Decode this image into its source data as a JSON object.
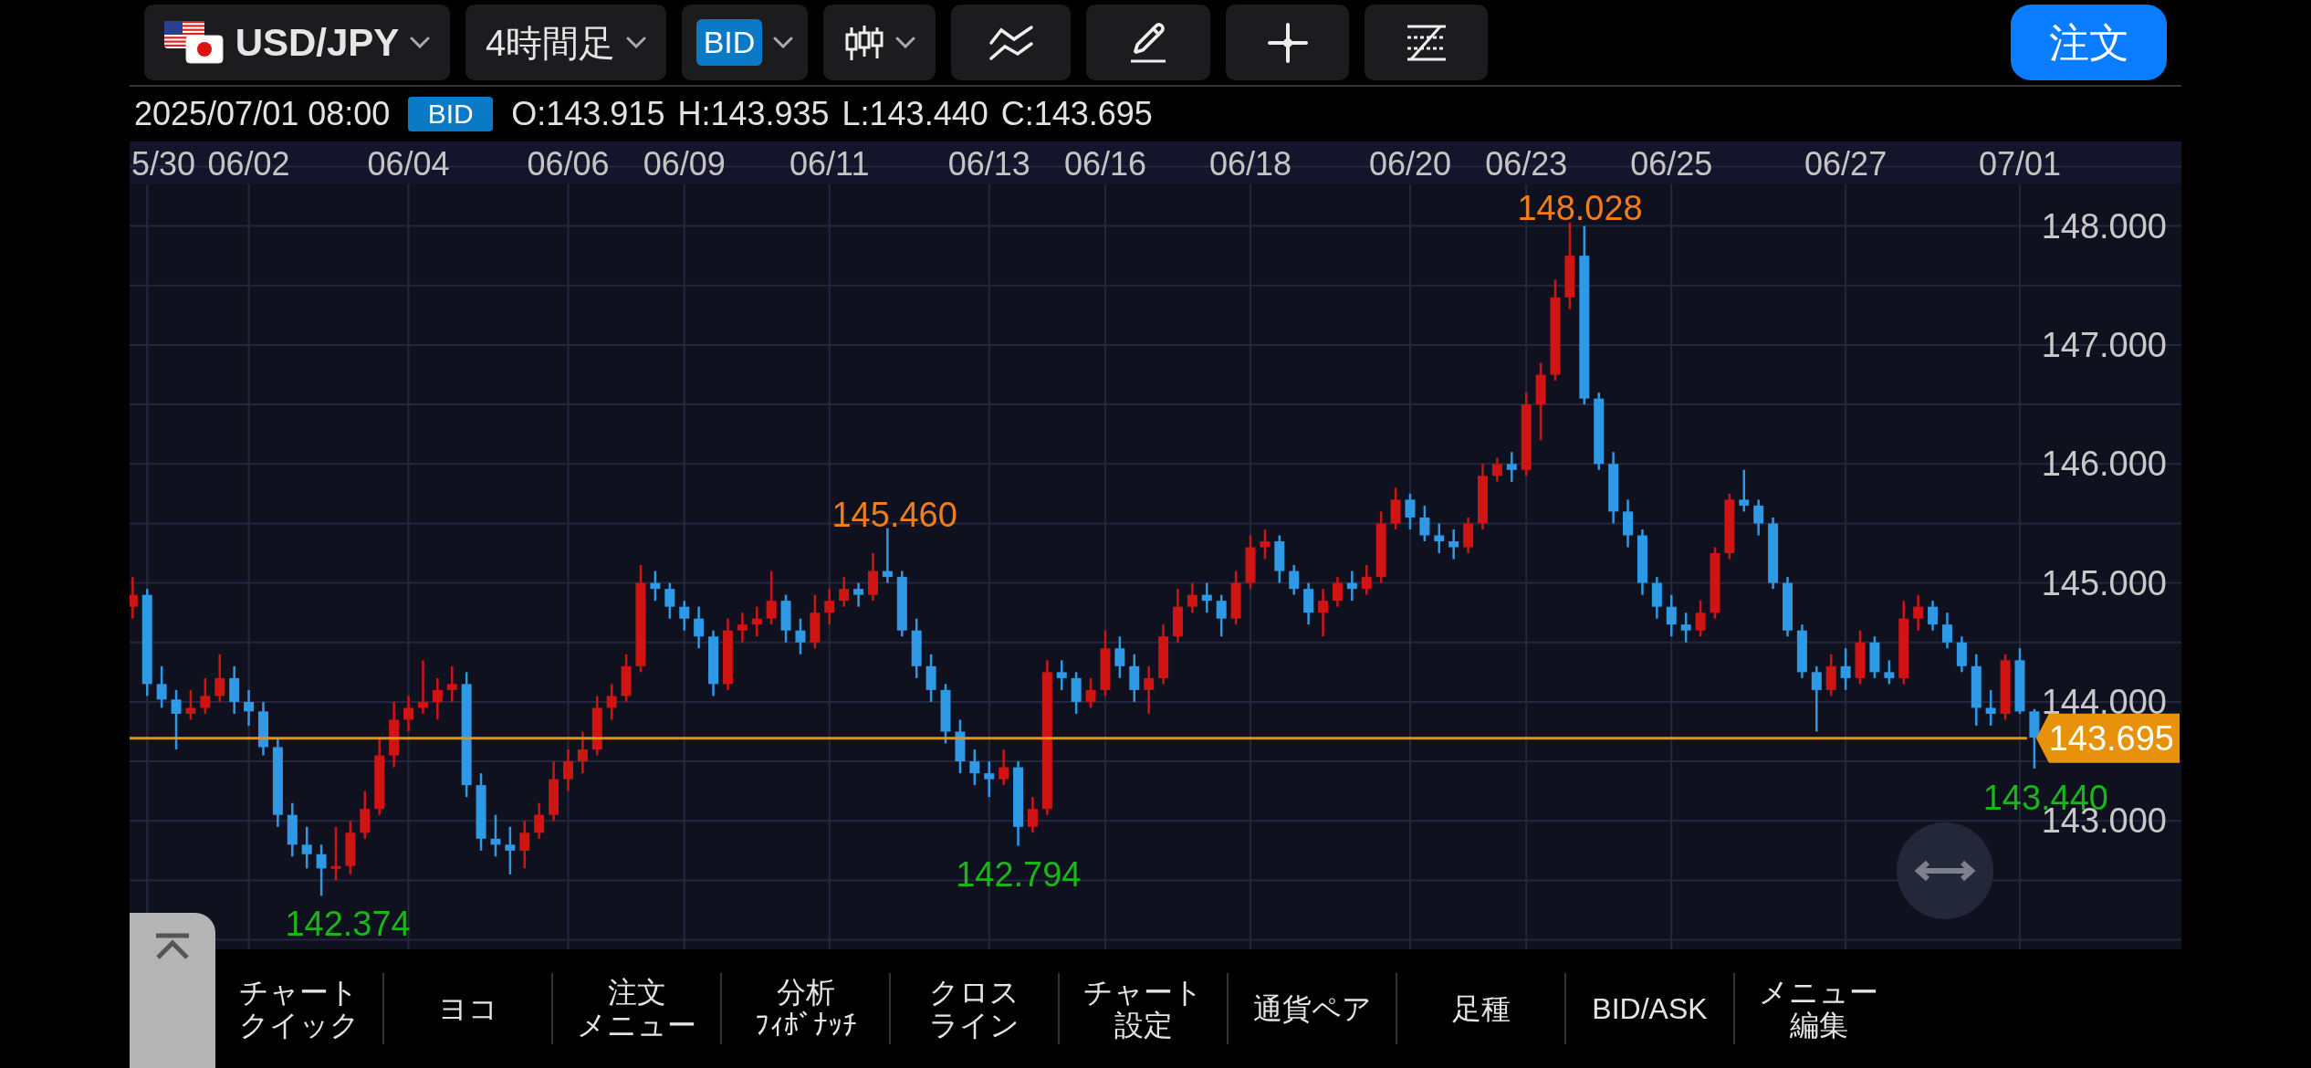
{
  "toolbar": {
    "symbol": "USD/JPY",
    "timeframe": "4時間足",
    "price_type": "BID",
    "order_button": "注文"
  },
  "info_bar": {
    "datetime": "2025/07/01 08:00",
    "price_type": "BID",
    "ohlc": [
      "O:143.915",
      "H:143.935",
      "L:143.440",
      "C:143.695"
    ]
  },
  "chart": {
    "x_labels": [
      "5/30",
      "06/02",
      "06/04",
      "06/06",
      "06/09",
      "06/11",
      "06/13",
      "06/16",
      "06/18",
      "06/20",
      "06/23",
      "06/25",
      "06/27",
      "07/01"
    ],
    "current_price": "143.695",
    "chart_data": {
      "type": "candlestick",
      "grid": true,
      "ylim": [
        141.92,
        148.35
      ],
      "ref_lines": [
        {
          "axis": "y",
          "value": 143.695,
          "color": "#e8920c"
        }
      ],
      "yticks": [
        {
          "value": 148,
          "label": "148.000"
        },
        {
          "value": 147,
          "label": "147.000"
        },
        {
          "value": 146,
          "label": "146.000"
        },
        {
          "value": 145,
          "label": "145.000"
        },
        {
          "value": 144,
          "label": "144.000"
        },
        {
          "value": 143,
          "label": "143.000"
        }
      ],
      "ohlc": [
        [
          144.8,
          145.05,
          144.7,
          144.9
        ],
        [
          144.9,
          144.95,
          144.05,
          144.15
        ],
        [
          144.15,
          144.3,
          143.95,
          144.02
        ],
        [
          144.02,
          144.1,
          143.6,
          143.9
        ],
        [
          143.9,
          144.1,
          143.85,
          143.95
        ],
        [
          143.95,
          144.2,
          143.9,
          144.05
        ],
        [
          144.05,
          144.4,
          144.0,
          144.2
        ],
        [
          144.2,
          144.3,
          143.9,
          144.0
        ],
        [
          144.0,
          144.1,
          143.8,
          143.92
        ],
        [
          143.92,
          144.0,
          143.55,
          143.62
        ],
        [
          143.62,
          143.7,
          142.95,
          143.05
        ],
        [
          143.05,
          143.15,
          142.7,
          142.8
        ],
        [
          142.8,
          142.95,
          142.6,
          142.72
        ],
        [
          142.72,
          142.8,
          142.37,
          142.6
        ],
        [
          142.6,
          142.95,
          142.5,
          142.62
        ],
        [
          142.62,
          143.0,
          142.55,
          142.9
        ],
        [
          142.9,
          143.25,
          142.85,
          143.1
        ],
        [
          143.1,
          143.7,
          143.05,
          143.55
        ],
        [
          143.55,
          144.0,
          143.45,
          143.85
        ],
        [
          143.85,
          144.05,
          143.75,
          143.95
        ],
        [
          143.95,
          144.35,
          143.9,
          144.0
        ],
        [
          144.0,
          144.2,
          143.85,
          144.1
        ],
        [
          144.1,
          144.3,
          144.0,
          144.15
        ],
        [
          144.15,
          144.25,
          143.2,
          143.3
        ],
        [
          143.3,
          143.4,
          142.75,
          142.85
        ],
        [
          142.85,
          143.05,
          142.7,
          142.8
        ],
        [
          142.8,
          142.95,
          142.55,
          142.75
        ],
        [
          142.75,
          143.0,
          142.6,
          142.9
        ],
        [
          142.9,
          143.15,
          142.85,
          143.05
        ],
        [
          143.05,
          143.5,
          143.0,
          143.35
        ],
        [
          143.35,
          143.6,
          143.25,
          143.5
        ],
        [
          143.5,
          143.75,
          143.4,
          143.6
        ],
        [
          143.6,
          144.05,
          143.55,
          143.95
        ],
        [
          143.95,
          144.15,
          143.85,
          144.05
        ],
        [
          144.05,
          144.4,
          144.0,
          144.3
        ],
        [
          144.3,
          145.15,
          144.25,
          145.0
        ],
        [
          145.0,
          145.1,
          144.85,
          144.95
        ],
        [
          144.95,
          145.0,
          144.7,
          144.8
        ],
        [
          144.8,
          144.85,
          144.6,
          144.7
        ],
        [
          144.7,
          144.8,
          144.45,
          144.55
        ],
        [
          144.55,
          144.6,
          144.05,
          144.15
        ],
        [
          144.15,
          144.7,
          144.1,
          144.6
        ],
        [
          144.6,
          144.75,
          144.5,
          144.65
        ],
        [
          144.65,
          144.8,
          144.55,
          144.7
        ],
        [
          144.7,
          145.1,
          144.65,
          144.85
        ],
        [
          144.85,
          144.9,
          144.5,
          144.6
        ],
        [
          144.6,
          144.7,
          144.4,
          144.5
        ],
        [
          144.5,
          144.9,
          144.45,
          144.75
        ],
        [
          144.75,
          144.95,
          144.65,
          144.85
        ],
        [
          144.85,
          145.05,
          144.8,
          144.95
        ],
        [
          144.95,
          145.0,
          144.8,
          144.9
        ],
        [
          144.9,
          145.25,
          144.85,
          145.1
        ],
        [
          145.1,
          145.46,
          145.0,
          145.05
        ],
        [
          145.05,
          145.1,
          144.55,
          144.6
        ],
        [
          144.6,
          144.7,
          144.2,
          144.3
        ],
        [
          144.3,
          144.4,
          144.0,
          144.1
        ],
        [
          144.1,
          144.15,
          143.65,
          143.75
        ],
        [
          143.75,
          143.85,
          143.4,
          143.5
        ],
        [
          143.5,
          143.6,
          143.3,
          143.4
        ],
        [
          143.4,
          143.5,
          143.2,
          143.35
        ],
        [
          143.35,
          143.6,
          143.3,
          143.45
        ],
        [
          143.45,
          143.5,
          142.79,
          142.95
        ],
        [
          142.95,
          143.2,
          142.9,
          143.1
        ],
        [
          143.1,
          144.35,
          143.05,
          144.25
        ],
        [
          144.25,
          144.35,
          144.1,
          144.2
        ],
        [
          144.2,
          144.25,
          143.9,
          144.0
        ],
        [
          144.0,
          144.2,
          143.95,
          144.1
        ],
        [
          144.1,
          144.6,
          144.05,
          144.45
        ],
        [
          144.45,
          144.55,
          144.2,
          144.3
        ],
        [
          144.3,
          144.4,
          144.0,
          144.1
        ],
        [
          144.1,
          144.3,
          143.9,
          144.2
        ],
        [
          144.2,
          144.65,
          144.15,
          144.55
        ],
        [
          144.55,
          144.95,
          144.5,
          144.8
        ],
        [
          144.8,
          145.0,
          144.75,
          144.9
        ],
        [
          144.9,
          145.0,
          144.75,
          144.85
        ],
        [
          144.85,
          144.9,
          144.55,
          144.7
        ],
        [
          144.7,
          145.1,
          144.65,
          145.0
        ],
        [
          145.0,
          145.4,
          144.95,
          145.3
        ],
        [
          145.3,
          145.45,
          145.2,
          145.35
        ],
        [
          145.35,
          145.4,
          145.0,
          145.1
        ],
        [
          145.1,
          145.15,
          144.9,
          144.95
        ],
        [
          144.95,
          145.0,
          144.65,
          144.75
        ],
        [
          144.75,
          144.95,
          144.55,
          144.85
        ],
        [
          144.85,
          145.05,
          144.8,
          145.0
        ],
        [
          145.0,
          145.1,
          144.85,
          144.95
        ],
        [
          144.95,
          145.15,
          144.9,
          145.05
        ],
        [
          145.05,
          145.6,
          145.0,
          145.5
        ],
        [
          145.5,
          145.8,
          145.45,
          145.7
        ],
        [
          145.7,
          145.75,
          145.45,
          145.55
        ],
        [
          145.55,
          145.65,
          145.35,
          145.4
        ],
        [
          145.4,
          145.5,
          145.25,
          145.35
        ],
        [
          145.35,
          145.45,
          145.2,
          145.3
        ],
        [
          145.3,
          145.55,
          145.25,
          145.5
        ],
        [
          145.5,
          146.0,
          145.45,
          145.9
        ],
        [
          145.9,
          146.05,
          145.85,
          146.0
        ],
        [
          146.0,
          146.1,
          145.85,
          145.95
        ],
        [
          145.95,
          146.6,
          145.9,
          146.5
        ],
        [
          146.5,
          146.85,
          146.2,
          146.75
        ],
        [
          146.75,
          147.55,
          146.7,
          147.4
        ],
        [
          147.4,
          148.03,
          147.3,
          147.75
        ],
        [
          147.75,
          148.0,
          146.5,
          146.55
        ],
        [
          146.55,
          146.6,
          145.95,
          146.0
        ],
        [
          146.0,
          146.1,
          145.5,
          145.6
        ],
        [
          145.6,
          145.7,
          145.3,
          145.4
        ],
        [
          145.4,
          145.45,
          144.9,
          145.0
        ],
        [
          145.0,
          145.05,
          144.7,
          144.8
        ],
        [
          144.8,
          144.9,
          144.55,
          144.65
        ],
        [
          144.65,
          144.75,
          144.5,
          144.6
        ],
        [
          144.6,
          144.85,
          144.55,
          144.75
        ],
        [
          144.75,
          145.3,
          144.7,
          145.25
        ],
        [
          145.25,
          145.75,
          145.2,
          145.7
        ],
        [
          145.7,
          145.95,
          145.6,
          145.65
        ],
        [
          145.65,
          145.7,
          145.4,
          145.5
        ],
        [
          145.5,
          145.55,
          144.95,
          145.0
        ],
        [
          145.0,
          145.05,
          144.55,
          144.6
        ],
        [
          144.6,
          144.65,
          144.2,
          144.25
        ],
        [
          144.25,
          144.3,
          143.75,
          144.1
        ],
        [
          144.1,
          144.4,
          144.05,
          144.3
        ],
        [
          144.3,
          144.45,
          144.1,
          144.2
        ],
        [
          144.2,
          144.6,
          144.15,
          144.5
        ],
        [
          144.5,
          144.55,
          144.2,
          144.25
        ],
        [
          144.25,
          144.35,
          144.15,
          144.2
        ],
        [
          144.2,
          144.85,
          144.15,
          144.7
        ],
        [
          144.7,
          144.9,
          144.6,
          144.8
        ],
        [
          144.8,
          144.85,
          144.6,
          144.65
        ],
        [
          144.65,
          144.75,
          144.45,
          144.5
        ],
        [
          144.5,
          144.55,
          144.25,
          144.3
        ],
        [
          144.3,
          144.4,
          143.8,
          143.95
        ],
        [
          143.95,
          144.1,
          143.8,
          143.9
        ],
        [
          143.9,
          144.4,
          143.85,
          144.35
        ],
        [
          144.35,
          144.45,
          143.9,
          143.92
        ],
        [
          143.92,
          143.94,
          143.44,
          143.7
        ]
      ]
    },
    "markers": [
      {
        "text": "148.028",
        "kind": "high"
      },
      {
        "text": "145.460",
        "kind": "high"
      },
      {
        "text": "142.794",
        "kind": "low"
      },
      {
        "text": "142.374",
        "kind": "low"
      },
      {
        "text": "143.440",
        "kind": "low"
      }
    ]
  },
  "bottom_menu": [
    {
      "lines": [
        "チャート",
        "クイック"
      ]
    },
    {
      "lines": [
        "ヨコ"
      ]
    },
    {
      "lines": [
        "注文",
        "メニュー"
      ]
    },
    {
      "lines": [
        "分析",
        "ﾌｨﾎﾞﾅｯﾁ"
      ]
    },
    {
      "lines": [
        "クロス",
        "ライン"
      ]
    },
    {
      "lines": [
        "チャート",
        "設定"
      ]
    },
    {
      "lines": [
        "通貨ペア"
      ]
    },
    {
      "lines": [
        "足種"
      ]
    },
    {
      "lines": [
        "BID/ASK"
      ]
    },
    {
      "lines": [
        "メニュー",
        "編集"
      ]
    }
  ]
}
